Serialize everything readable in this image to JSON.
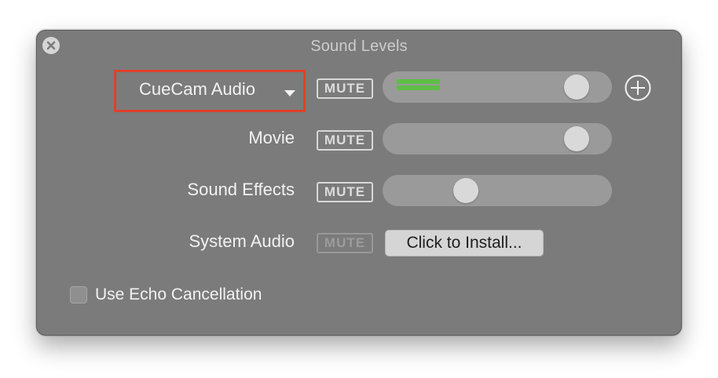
{
  "window": {
    "title": "Sound Levels"
  },
  "rows": [
    {
      "label": "CueCam Audio",
      "mute_label": "MUTE",
      "volume": 0.9,
      "meter_level": 0.19
    },
    {
      "label": "Movie",
      "mute_label": "MUTE",
      "volume": 0.9
    },
    {
      "label": "Sound Effects",
      "mute_label": "MUTE",
      "volume": 0.34
    },
    {
      "label": "System Audio",
      "mute_label": "MUTE",
      "install_label": "Click to Install..."
    }
  ],
  "echo_cancellation": {
    "label": "Use Echo Cancellation",
    "checked": false
  },
  "icons": {
    "close": "close-icon",
    "dropdown": "chevron-down-icon",
    "add": "plus-circle-icon"
  },
  "colors": {
    "window_bg": "#7b7b7b",
    "highlight_border": "#e0402a",
    "meter": "#5fbe45"
  }
}
